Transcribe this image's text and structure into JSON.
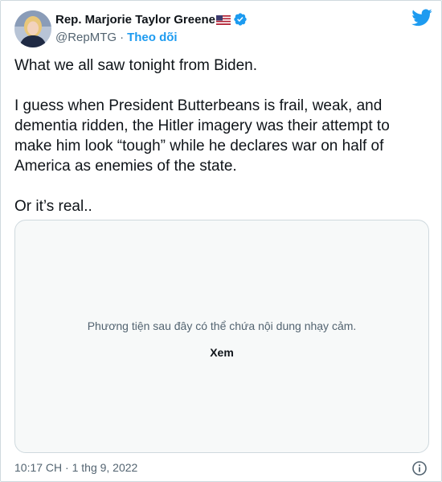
{
  "user": {
    "display_name": "Rep. Marjorie Taylor Greene",
    "handle": "@RepMTG",
    "separator": "·",
    "follow_label": "Theo dõi",
    "flag_icon": "us-flag-icon",
    "verified_icon": "verified-badge-icon",
    "avatar_icon": "profile-avatar"
  },
  "tweet": {
    "paragraphs": [
      "What we all saw tonight from Biden.",
      "I guess when President Butterbeans is frail, weak, and dementia ridden, the Hitler imagery was their attempt to make him look “tough” while he declares war on half of America as enemies of the state.",
      "Or it’s real.."
    ]
  },
  "media": {
    "warning_text": "Phương tiện sau đây có thể chứa nội dung nhạy cảm.",
    "view_label": "Xem"
  },
  "footer": {
    "timestamp": "10:17 CH · 1 thg 9, 2022",
    "info_icon": "info-icon"
  },
  "colors": {
    "accent": "#1d9bf0",
    "text": "#0f1419",
    "secondary": "#536471",
    "border": "#cfd9de",
    "media_bg": "#f7f9f9"
  }
}
